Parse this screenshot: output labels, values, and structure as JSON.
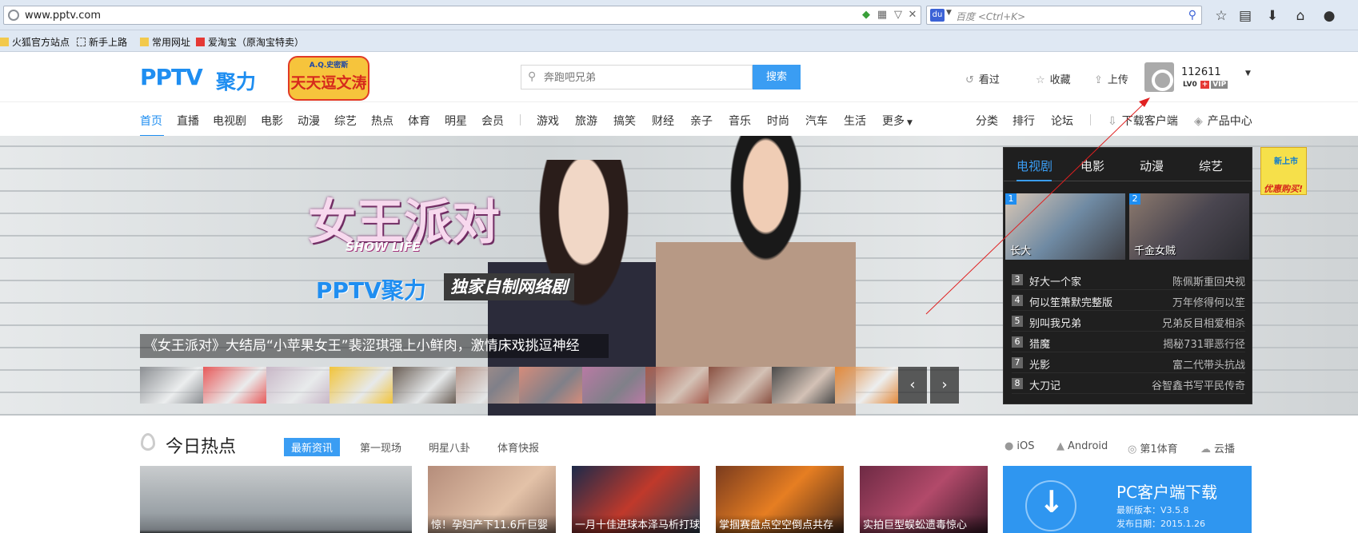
{
  "browser": {
    "url": "www.pptv.com",
    "search_placeholder": "百度 <Ctrl+K>",
    "bookmarks": [
      "火狐官方站点",
      "新手上路",
      "常用网址",
      "爱淘宝（原淘宝特卖）"
    ]
  },
  "header": {
    "logo": "PPTV",
    "logo_sub": "聚力",
    "promo_top": "A.Q.史密斯",
    "promo_main": "天天逗文涛",
    "search_placeholder": "奔跑吧兄弟",
    "search_button": "搜索",
    "links": [
      "看过",
      "收藏",
      "上传"
    ],
    "user_name": "112611",
    "user_badges": [
      "LV0",
      "VIP"
    ]
  },
  "nav": {
    "main": [
      "首页",
      "直播",
      "电视剧",
      "电影",
      "动漫",
      "综艺",
      "热点",
      "体育",
      "明星",
      "会员"
    ],
    "secondary": [
      "游戏",
      "旅游",
      "搞笑",
      "财经",
      "亲子",
      "音乐",
      "时尚",
      "汽车",
      "生活",
      "更多"
    ],
    "right": [
      "分类",
      "排行",
      "论坛",
      "下载客户端",
      "产品中心"
    ],
    "active": "首页"
  },
  "banner": {
    "show_title": "女王派对",
    "show_subtitle": "SHOW LIFE",
    "brand": "PPTV聚力",
    "brand_tag": "独家自制网络剧",
    "caption": "《女王派对》大结局“小苹果女王”裴涩琪强上小鲜肉，激情床戏挑逗神经",
    "thumb_colors": [
      "#8c8f93",
      "#e85a5a",
      "#c9b8c8",
      "#f2c43b",
      "#6a5e55",
      "#b8968a",
      "#d58c7b",
      "#b87aa4",
      "#a65b4d",
      "#8a5142",
      "#4a4a4a",
      "#e38a3c"
    ]
  },
  "ranking": {
    "tabs": [
      "电视剧",
      "电影",
      "动漫",
      "综艺"
    ],
    "active_tab": "电视剧",
    "top": [
      {
        "num": "1",
        "title": "长大"
      },
      {
        "num": "2",
        "title": "千金女贼"
      }
    ],
    "rows": [
      {
        "num": "3",
        "title": "好大一个家",
        "desc": "陈佩斯重回央视"
      },
      {
        "num": "4",
        "title": "何以笙箫默完整版",
        "desc": "万年修得何以笙"
      },
      {
        "num": "5",
        "title": "别叫我兄弟",
        "desc": "兄弟反目相爱相杀"
      },
      {
        "num": "6",
        "title": "猎魔",
        "desc": "揭秘731罪恶行径"
      },
      {
        "num": "7",
        "title": "光影",
        "desc": "富二代带头抗战"
      },
      {
        "num": "8",
        "title": "大刀记",
        "desc": "谷智鑫书写平民传奇"
      }
    ]
  },
  "side_ad": {
    "badge": "新上市",
    "text": "优惠购买!"
  },
  "hot": {
    "title": "今日热点",
    "tabs": [
      "最新资讯",
      "第一现场",
      "明星八卦",
      "体育快报"
    ],
    "active_tab": "最新资讯",
    "platforms": [
      "iOS",
      "Android",
      "第1体育",
      "云播"
    ],
    "cards": [
      "",
      "惊！孕妇产下11.6斤巨婴",
      "一月十佳进球本泽马析打球",
      "掌掴赛盘点空空倒点共存",
      "实拍巨型蜈蚣遗毒惊心"
    ],
    "download": {
      "title": "PC客户端下载",
      "version": "最新版本：V3.5.8",
      "date": "发布日期：2015.1.26"
    }
  },
  "colors": {
    "accent": "#1f8ef1",
    "button": "#3a9df3",
    "panel": "#1f1f1f",
    "annotation": "#e02020"
  }
}
